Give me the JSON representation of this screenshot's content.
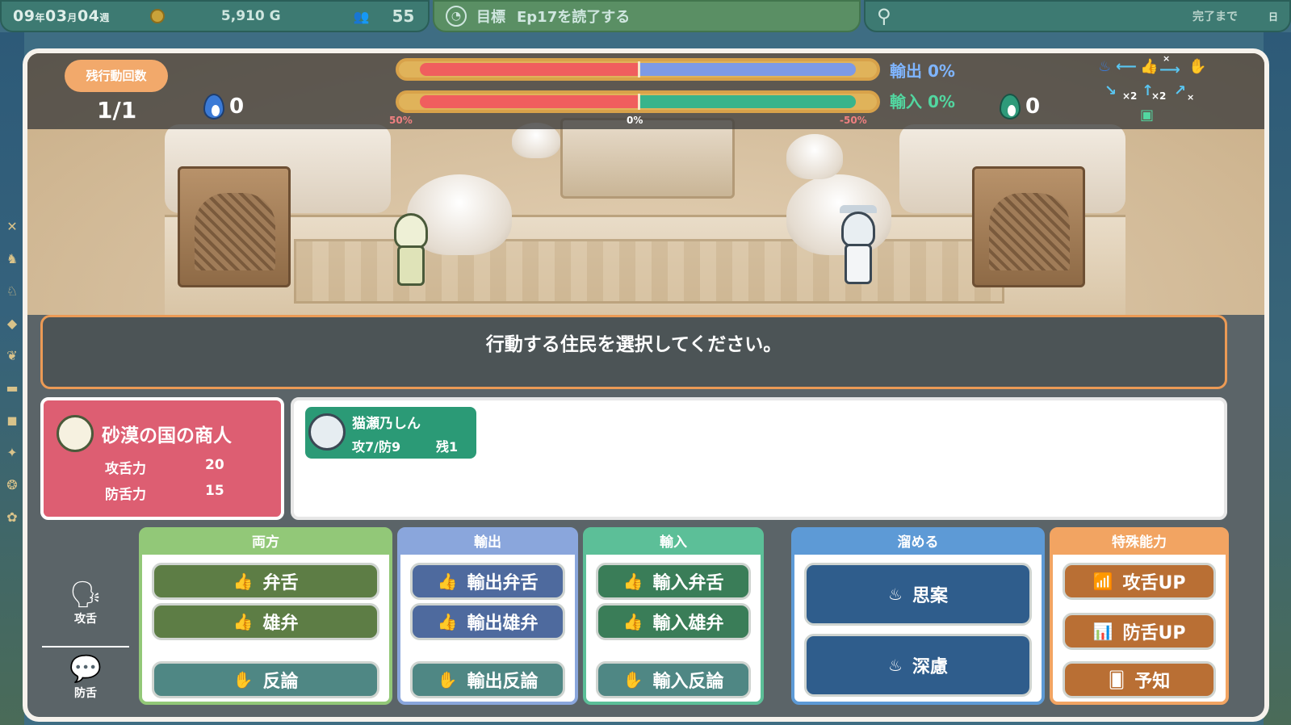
{
  "hud": {
    "date_month": "09",
    "date_month_unit": "年",
    "date_day": "03",
    "date_day_unit": "月",
    "date_week": "04",
    "date_week_unit": "週",
    "gold": "5,910 G",
    "population": "55",
    "goal_label": "目標",
    "goal_text": "Ep17を読了する",
    "done_label": "完了まで",
    "done_box": "日"
  },
  "battle": {
    "remaining_label": "残行動回数",
    "remaining_value": "1/1",
    "left_flame": "0",
    "right_flame": "0",
    "bar_out_label": "輸出",
    "bar_out_value": "0%",
    "bar_in_label": "輸入",
    "bar_in_value": "0%",
    "tick_left": "50%",
    "tick_mid": "0%",
    "tick_right": "-50%",
    "bar_out_fraction": 0.5,
    "bar_in_fraction": 0.5,
    "legend": {
      "x2a": "×2",
      "x2b": "×2",
      "xa": "×",
      "xb": "×"
    }
  },
  "message": "行動する住民を選択してください。",
  "enemy": {
    "name": "砂漠の国の商人",
    "atk_label": "攻舌力",
    "atk_value": "20",
    "def_label": "防舌力",
    "def_value": "15"
  },
  "residents": [
    {
      "name": "猫瀬乃しん",
      "stats": "攻7/防9",
      "left": "残1"
    }
  ],
  "mode": {
    "attack": "攻舌",
    "defense": "防舌"
  },
  "panels": {
    "both": {
      "title": "両方",
      "b1": "弁舌",
      "b2": "雄弁",
      "b3": "反論"
    },
    "out": {
      "title": "輸出",
      "b1": "輸出弁舌",
      "b2": "輸出雄弁",
      "b3": "輸出反論"
    },
    "in": {
      "title": "輸入",
      "b1": "輸入弁舌",
      "b2": "輸入雄弁",
      "b3": "輸入反論"
    },
    "charge": {
      "title": "溜める",
      "b1": "思案",
      "b2": "深慮"
    },
    "special": {
      "title": "特殊能力",
      "b1": "攻舌UP",
      "b2": "防舌UP",
      "b3": "予知"
    }
  },
  "colors": {
    "accent_orange": "#eb9a55",
    "enemy_red": "#dd5e72",
    "resident_green": "#2b9a76",
    "bar_red": "#f05e5e",
    "bar_blue": "#7d9ae6",
    "bar_green": "#39b48b"
  }
}
